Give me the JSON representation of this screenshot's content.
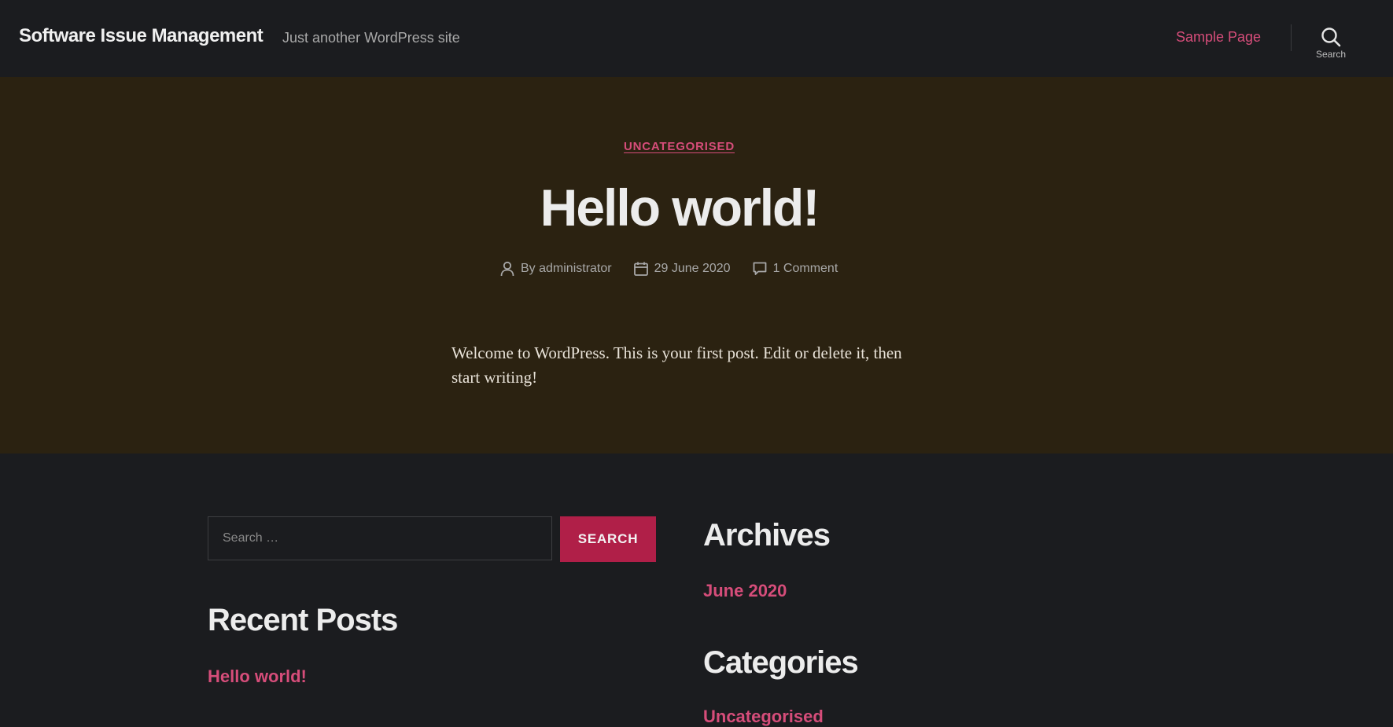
{
  "header": {
    "site_title": "Software Issue Management",
    "site_description": "Just another WordPress site",
    "nav_items": [
      {
        "label": "Sample Page"
      }
    ],
    "search_toggle_label": "Search"
  },
  "post": {
    "category": "UNCATEGORISED",
    "title": "Hello world!",
    "meta": {
      "author": "By administrator",
      "date": "29 June 2020",
      "comments": "1 Comment"
    },
    "body_text": "Welcome to WordPress. This is your first post. Edit or delete it, then start writing!"
  },
  "widgets": {
    "search": {
      "placeholder": "Search …",
      "button_label": "SEARCH"
    },
    "recent_posts": {
      "title": "Recent Posts",
      "items": [
        "Hello world!"
      ]
    },
    "archives": {
      "title": "Archives",
      "items": [
        "June 2020"
      ]
    },
    "categories": {
      "title": "Categories",
      "items": [
        "Uncategorised"
      ]
    }
  },
  "colors": {
    "accent": "#d64d7a",
    "button_bg": "#b01f48",
    "header_bg": "#1b1c1f",
    "post_bg": "#2b2211"
  },
  "icons": {
    "search": "search-icon",
    "author": "user-icon",
    "date": "calendar-icon",
    "comments": "comment-icon"
  }
}
